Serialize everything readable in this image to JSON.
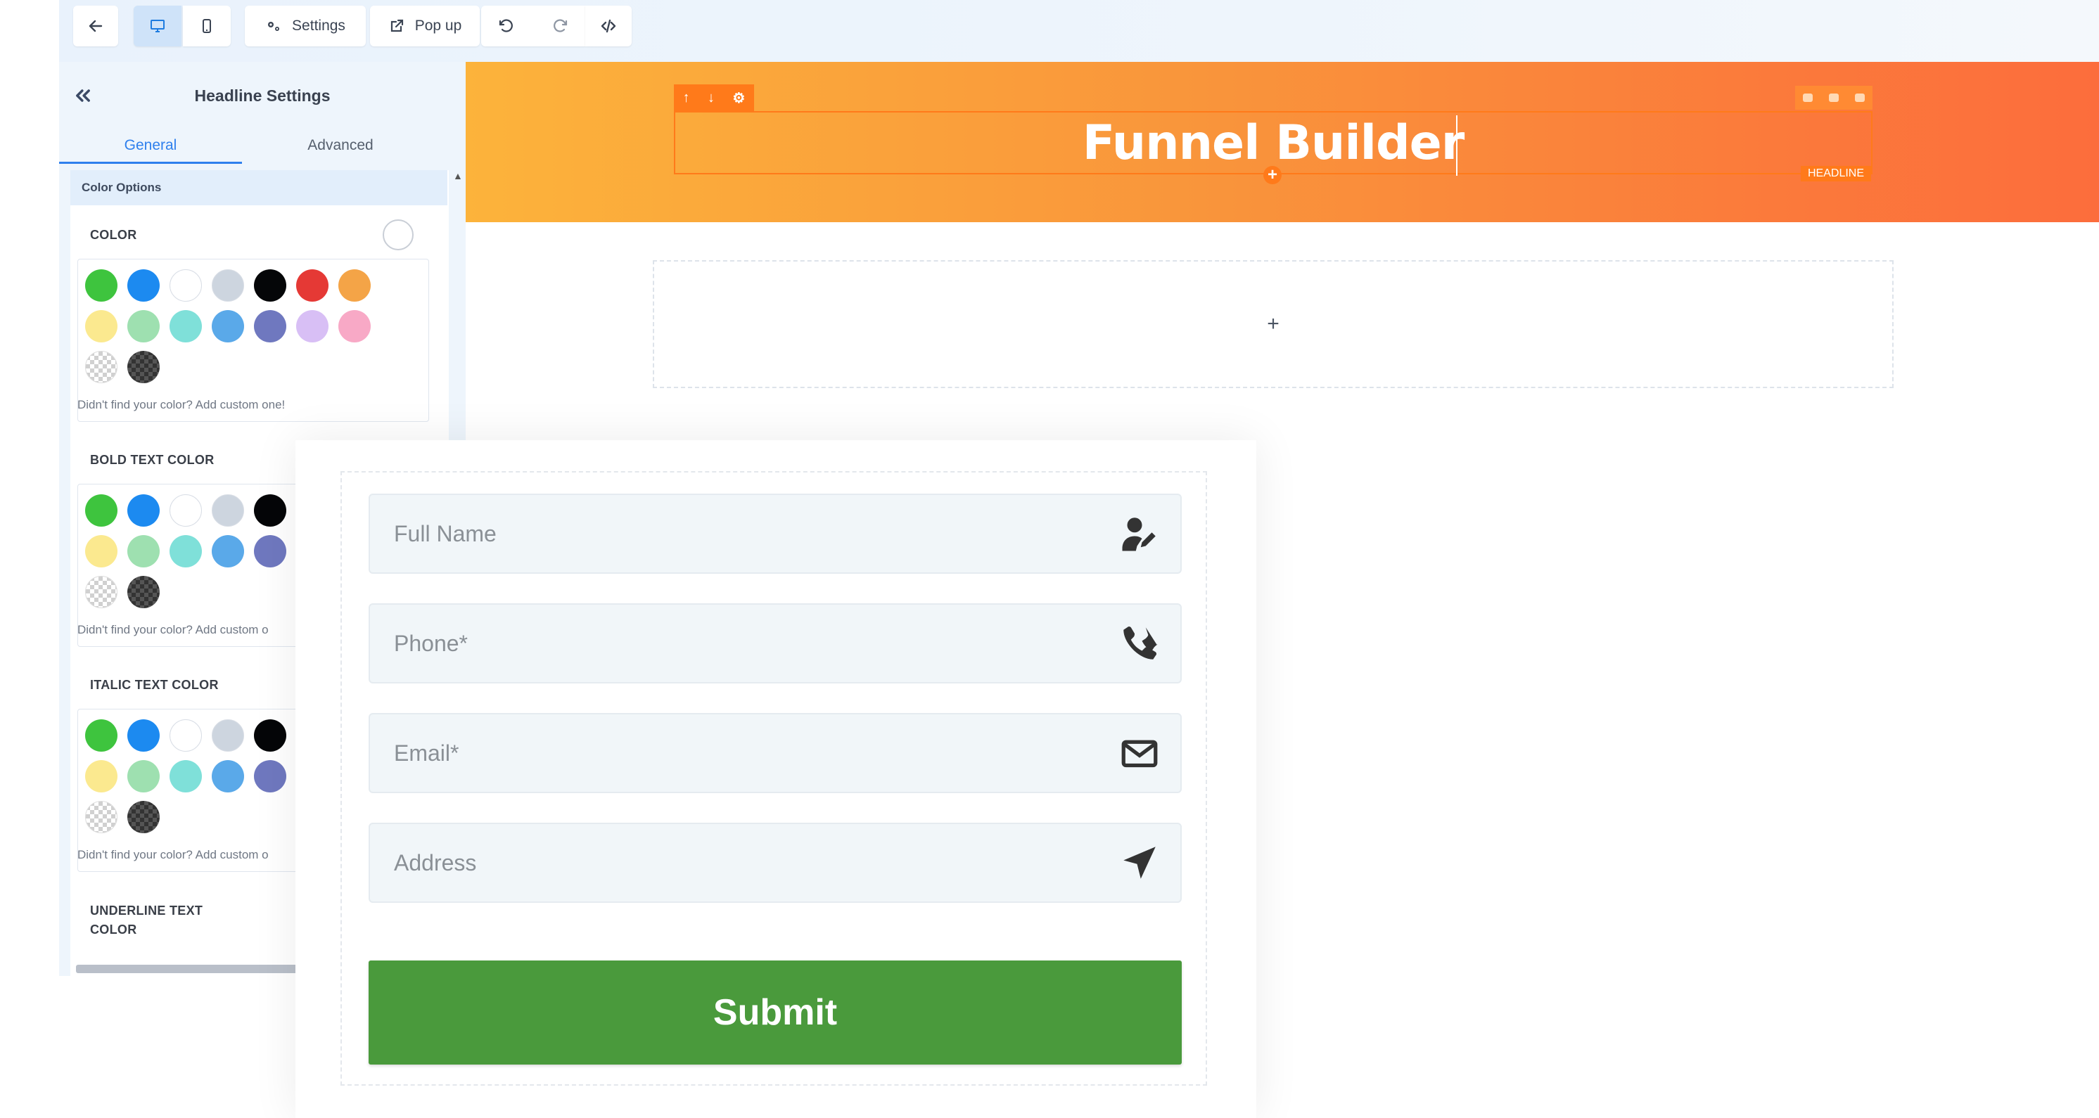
{
  "toolbar": {
    "settings_label": "Settings",
    "popup_label": "Pop up"
  },
  "panel": {
    "title": "Headline Settings",
    "tabs": [
      {
        "label": "General"
      },
      {
        "label": "Advanced"
      }
    ],
    "section_title": "Color Options",
    "color_label": "COLOR",
    "bold_label": "BOLD TEXT COLOR",
    "italic_label": "ITALIC TEXT COLOR",
    "underline_label": "UNDERLINE TEXT COLOR",
    "custom_hint_full": "Didn't find your color? Add custom one!",
    "custom_hint_cut": "Didn't find your color? Add custom o",
    "swatches_row1": [
      "#3ec43e",
      "#1c8af0",
      "#ffffff",
      "#cdd5df",
      "#050608",
      "#e53935",
      "#f4a447"
    ],
    "swatches_row2": [
      "#fbe98f",
      "#9ee0b0",
      "#7fe0d9",
      "#5aa9e9",
      "#6f78bf",
      "#d8bff5",
      "#f8a9c6"
    ]
  },
  "canvas": {
    "headline": "Funnel Builder",
    "headline_tag": "HEADLINE",
    "drop_plus": "+",
    "hero_gradient": [
      "#fcb33b",
      "#fc6d3c"
    ],
    "accent": "#ff7a1a"
  },
  "form": {
    "fields": [
      {
        "placeholder": "Full Name",
        "icon": "user-edit-icon"
      },
      {
        "placeholder": "Phone*",
        "icon": "phone-icon"
      },
      {
        "placeholder": "Email*",
        "icon": "envelope-icon"
      },
      {
        "placeholder": "Address",
        "icon": "location-arrow-icon"
      }
    ],
    "submit_label": "Submit",
    "submit_color": "#4a9a3c"
  }
}
